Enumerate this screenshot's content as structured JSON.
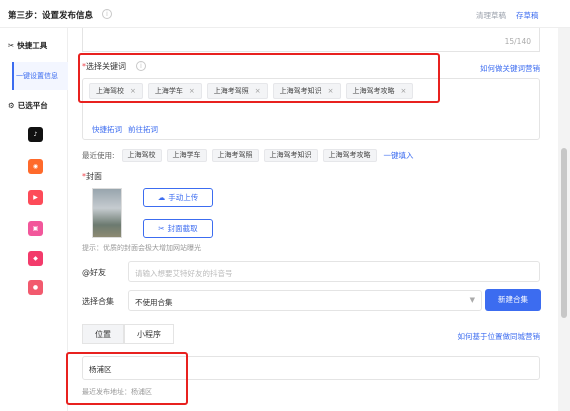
{
  "header": {
    "step_title": "第三步：设置发布信息",
    "info_icon": "info-icon",
    "clear_draft": "清理草稿",
    "save_draft": "存草稿"
  },
  "sidebar": {
    "quick_tools": "快捷工具",
    "quick_tools_icon": "scissors-icon",
    "active_item": "一键设置信息",
    "selected_platforms": "已选平台",
    "selected_platforms_icon": "gear-icon",
    "platforms": [
      {
        "name": "tiktok-icon",
        "color": "#111111",
        "glyph": "♪"
      },
      {
        "name": "kuaishou-icon",
        "color": "#ff6a2b",
        "glyph": "◉"
      },
      {
        "name": "xigua-icon",
        "color": "#fd4b59",
        "glyph": "▶"
      },
      {
        "name": "bilibili-icon",
        "color": "#f2579b",
        "glyph": "▣"
      },
      {
        "name": "meipai-icon",
        "color": "#f33b6b",
        "glyph": "◆"
      },
      {
        "name": "weishi-icon",
        "color": "#f25a6e",
        "glyph": "●"
      }
    ]
  },
  "title_field": {
    "count": "15/140"
  },
  "keywords": {
    "label": "选择关键词",
    "required_mark": "*",
    "help_link": "如何做关键词营销",
    "tags": [
      "上海驾校",
      "上海学车",
      "上海考驾照",
      "上海驾考知识",
      "上海驾考攻略"
    ],
    "expand_link": "快捷拓词",
    "prev_link": "前往拓词"
  },
  "recent": {
    "label": "最近使用:",
    "tags": [
      "上海驾校",
      "上海学车",
      "上海考驾照",
      "上海驾考知识",
      "上海驾考攻略"
    ],
    "fill_all": "一键填入"
  },
  "cover": {
    "label": "封面",
    "required_mark": "*",
    "upload_btn": "手动上传",
    "upload_icon": "upload-cloud-icon",
    "capture_btn": "封面截取",
    "capture_icon": "scissors-icon",
    "tip": "提示：优质的封面会极大增加网站曝光"
  },
  "friends": {
    "label": "@好友",
    "placeholder": "请输入想要艾特好友的抖音号"
  },
  "collection": {
    "label": "选择合集",
    "value": "不使用合集",
    "new_btn": "新建合集"
  },
  "location": {
    "tabs": [
      "位置",
      "小程序"
    ],
    "help_link": "如何基于位置做同城营销",
    "value": "杨浦区",
    "recent": "最近发布地址：杨浦区"
  },
  "colors": {
    "accent": "#3c6cf0",
    "highlight": "#e8211f"
  }
}
